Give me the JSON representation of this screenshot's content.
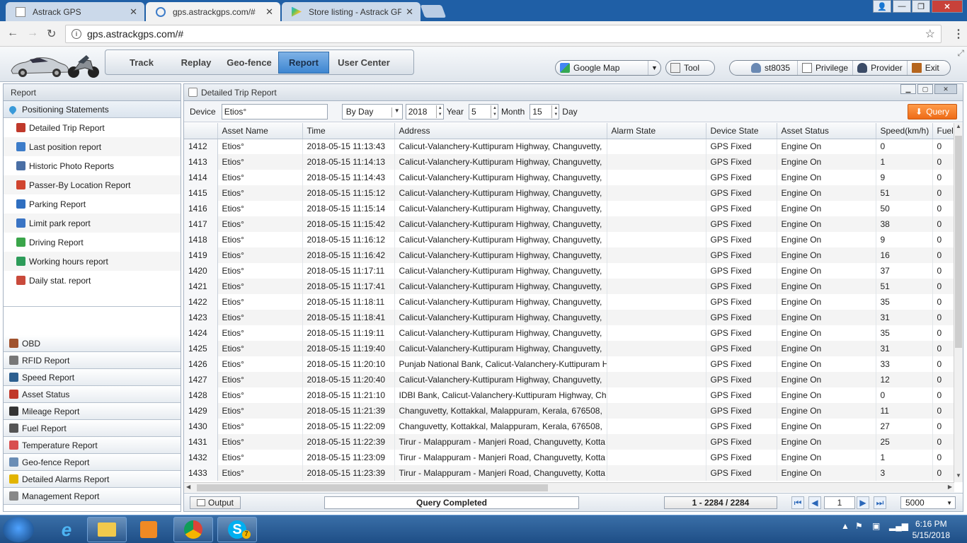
{
  "browser": {
    "tabs": [
      {
        "title": "Astrack GPS",
        "active": false
      },
      {
        "title": "gps.astrackgps.com/#",
        "active": true
      },
      {
        "title": "Store listing - Astrack GP",
        "active": false
      }
    ],
    "url": "gps.astrackgps.com/#"
  },
  "header": {
    "nav": [
      {
        "label": "Track",
        "active": false
      },
      {
        "label": "Replay",
        "active": false
      },
      {
        "label": "Geo-fence",
        "active": false
      },
      {
        "label": "Report",
        "active": true
      },
      {
        "label": "User Center",
        "active": false
      }
    ],
    "map_label": "Google Map",
    "tool_label": "Tool",
    "user": "st8035",
    "privilege": "Privilege",
    "provider": "Provider",
    "exit": "Exit"
  },
  "sidebar": {
    "title": "Report",
    "open_group": "Positioning Statements",
    "items": [
      {
        "label": "Detailed Trip Report",
        "icon": "trip-report-icon",
        "color": "#c0392b"
      },
      {
        "label": "Last position report",
        "icon": "last-position-icon",
        "color": "#3d7cc9"
      },
      {
        "label": "Historic Photo Reports",
        "icon": "photo-icon",
        "color": "#4a6fa5"
      },
      {
        "label": "Passer-By Location Report",
        "icon": "location-icon",
        "color": "#d0452f"
      },
      {
        "label": "Parking Report",
        "icon": "parking-icon",
        "color": "#2f6fc0"
      },
      {
        "label": "Limit park report",
        "icon": "limit-park-icon",
        "color": "#3a74c4"
      },
      {
        "label": "Driving Report",
        "icon": "driving-icon",
        "color": "#3aa54a"
      },
      {
        "label": "Working hours report",
        "icon": "working-hours-icon",
        "color": "#2e9c5a"
      },
      {
        "label": "Daily stat. report",
        "icon": "calendar-icon",
        "color": "#c94a3b"
      }
    ],
    "groups": [
      {
        "label": "OBD",
        "icon": "obd-icon",
        "color": "#a0522d"
      },
      {
        "label": "RFID Report",
        "icon": "rfid-icon",
        "color": "#777777"
      },
      {
        "label": "Speed Report",
        "icon": "speed-icon",
        "color": "#2d5f8f"
      },
      {
        "label": "Asset Status",
        "icon": "car-icon",
        "color": "#c0392b"
      },
      {
        "label": "Mileage Report",
        "icon": "mileage-icon",
        "color": "#333333"
      },
      {
        "label": "Fuel Report",
        "icon": "fuel-icon",
        "color": "#555555"
      },
      {
        "label": "Temperature Report",
        "icon": "temperature-icon",
        "color": "#d84f4f"
      },
      {
        "label": "Geo-fence Report",
        "icon": "geofence-icon",
        "color": "#6a8db5"
      },
      {
        "label": "Detailed Alarms Report",
        "icon": "alarm-icon",
        "color": "#e2b400"
      },
      {
        "label": "Management Report",
        "icon": "management-icon",
        "color": "#888888"
      }
    ]
  },
  "report": {
    "title": "Detailed Trip Report",
    "filter": {
      "device_label": "Device",
      "device_value": "Etios°",
      "period": "By Day",
      "year": "2018",
      "year_label": "Year",
      "month": "5",
      "month_label": "Month",
      "day": "15",
      "day_label": "Day",
      "query_label": "Query"
    },
    "columns": [
      "Asset Name",
      "Time",
      "Address",
      "Alarm State",
      "Device State",
      "Asset Status",
      "Speed(km/h)",
      "Fuel"
    ],
    "rows": [
      [
        "1412",
        "Etios°",
        "2018-05-15 11:13:43",
        "Calicut-Valanchery-Kuttipuram Highway, Changuvetty,",
        "",
        "GPS Fixed",
        "Engine On",
        "0",
        "0"
      ],
      [
        "1413",
        "Etios°",
        "2018-05-15 11:14:13",
        "Calicut-Valanchery-Kuttipuram Highway, Changuvetty,",
        "",
        "GPS Fixed",
        "Engine On",
        "1",
        "0"
      ],
      [
        "1414",
        "Etios°",
        "2018-05-15 11:14:43",
        "Calicut-Valanchery-Kuttipuram Highway, Changuvetty,",
        "",
        "GPS Fixed",
        "Engine On",
        "9",
        "0"
      ],
      [
        "1415",
        "Etios°",
        "2018-05-15 11:15:12",
        "Calicut-Valanchery-Kuttipuram Highway, Changuvetty,",
        "",
        "GPS Fixed",
        "Engine On",
        "51",
        "0"
      ],
      [
        "1416",
        "Etios°",
        "2018-05-15 11:15:14",
        "Calicut-Valanchery-Kuttipuram Highway, Changuvetty,",
        "",
        "GPS Fixed",
        "Engine On",
        "50",
        "0"
      ],
      [
        "1417",
        "Etios°",
        "2018-05-15 11:15:42",
        "Calicut-Valanchery-Kuttipuram Highway, Changuvetty,",
        "",
        "GPS Fixed",
        "Engine On",
        "38",
        "0"
      ],
      [
        "1418",
        "Etios°",
        "2018-05-15 11:16:12",
        "Calicut-Valanchery-Kuttipuram Highway, Changuvetty,",
        "",
        "GPS Fixed",
        "Engine On",
        "9",
        "0"
      ],
      [
        "1419",
        "Etios°",
        "2018-05-15 11:16:42",
        "Calicut-Valanchery-Kuttipuram Highway, Changuvetty,",
        "",
        "GPS Fixed",
        "Engine On",
        "16",
        "0"
      ],
      [
        "1420",
        "Etios°",
        "2018-05-15 11:17:11",
        "Calicut-Valanchery-Kuttipuram Highway, Changuvetty,",
        "",
        "GPS Fixed",
        "Engine On",
        "37",
        "0"
      ],
      [
        "1421",
        "Etios°",
        "2018-05-15 11:17:41",
        "Calicut-Valanchery-Kuttipuram Highway, Changuvetty,",
        "",
        "GPS Fixed",
        "Engine On",
        "51",
        "0"
      ],
      [
        "1422",
        "Etios°",
        "2018-05-15 11:18:11",
        "Calicut-Valanchery-Kuttipuram Highway, Changuvetty,",
        "",
        "GPS Fixed",
        "Engine On",
        "35",
        "0"
      ],
      [
        "1423",
        "Etios°",
        "2018-05-15 11:18:41",
        "Calicut-Valanchery-Kuttipuram Highway, Changuvetty,",
        "",
        "GPS Fixed",
        "Engine On",
        "31",
        "0"
      ],
      [
        "1424",
        "Etios°",
        "2018-05-15 11:19:11",
        "Calicut-Valanchery-Kuttipuram Highway, Changuvetty,",
        "",
        "GPS Fixed",
        "Engine On",
        "35",
        "0"
      ],
      [
        "1425",
        "Etios°",
        "2018-05-15 11:19:40",
        "Calicut-Valanchery-Kuttipuram Highway, Changuvetty,",
        "",
        "GPS Fixed",
        "Engine On",
        "31",
        "0"
      ],
      [
        "1426",
        "Etios°",
        "2018-05-15 11:20:10",
        "Punjab National Bank, Calicut-Valanchery-Kuttipuram H",
        "",
        "GPS Fixed",
        "Engine On",
        "33",
        "0"
      ],
      [
        "1427",
        "Etios°",
        "2018-05-15 11:20:40",
        "Calicut-Valanchery-Kuttipuram Highway, Changuvetty,",
        "",
        "GPS Fixed",
        "Engine On",
        "12",
        "0"
      ],
      [
        "1428",
        "Etios°",
        "2018-05-15 11:21:10",
        "IDBI Bank, Calicut-Valanchery-Kuttipuram Highway, Ch",
        "",
        "GPS Fixed",
        "Engine On",
        "0",
        "0"
      ],
      [
        "1429",
        "Etios°",
        "2018-05-15 11:21:39",
        "Changuvetty, Kottakkal, Malappuram, Kerala, 676508, ",
        "",
        "GPS Fixed",
        "Engine On",
        "11",
        "0"
      ],
      [
        "1430",
        "Etios°",
        "2018-05-15 11:22:09",
        "Changuvetty, Kottakkal, Malappuram, Kerala, 676508, ",
        "",
        "GPS Fixed",
        "Engine On",
        "27",
        "0"
      ],
      [
        "1431",
        "Etios°",
        "2018-05-15 11:22:39",
        "Tirur - Malappuram - Manjeri Road, Changuvetty, Kotta",
        "",
        "GPS Fixed",
        "Engine On",
        "25",
        "0"
      ],
      [
        "1432",
        "Etios°",
        "2018-05-15 11:23:09",
        "Tirur - Malappuram - Manjeri Road, Changuvetty, Kotta",
        "",
        "GPS Fixed",
        "Engine On",
        "1",
        "0"
      ],
      [
        "1433",
        "Etios°",
        "2018-05-15 11:23:39",
        "Tirur - Malappuram - Manjeri Road, Changuvetty, Kotta",
        "",
        "GPS Fixed",
        "Engine On",
        "3",
        "0"
      ]
    ],
    "footer": {
      "output_label": "Output",
      "status": "Query Completed",
      "range": "1 - 2284 / 2284",
      "page": "1",
      "page_size": "5000"
    }
  },
  "taskbar": {
    "time": "6:16 PM",
    "date": "5/15/2018",
    "skype_badge": "7"
  }
}
